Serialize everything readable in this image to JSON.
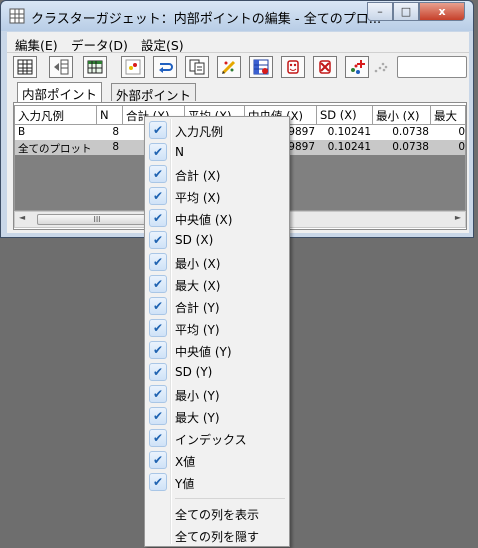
{
  "window": {
    "title": "クラスターガジェット：内部ポイントの編集 - 全てのプロ...",
    "buttons": {
      "minimize": "–",
      "maximize": "□",
      "close": "x"
    }
  },
  "menu": [
    "編集(E)",
    "データ(D)",
    "設定(S)"
  ],
  "toolbar_icons": [
    "worksheet-icon",
    "move-column-icon",
    "table-icon",
    "scatter-icon",
    "undo-loop-icon",
    "copy-icon",
    "edit-pen-icon",
    "grid-select-icon",
    "mask-face-icon",
    "mask-remove-icon",
    "add-points-icon",
    "scatter-gray-icon"
  ],
  "tabs": [
    "内部ポイント",
    "外部ポイント"
  ],
  "table": {
    "columns": [
      "入力凡例",
      "N",
      "合計 (X)",
      "平均 (X)",
      "中央値 (X)",
      "SD (X)",
      "最小 (X)",
      "最大"
    ],
    "rows": [
      [
        "B",
        "8",
        "",
        "",
        "19897",
        "0.10241",
        "0.0738",
        "0"
      ],
      [
        "全てのプロット",
        "8",
        "",
        "",
        "19897",
        "0.10241",
        "0.0738",
        "0"
      ]
    ]
  },
  "scrollbar": {
    "left_arrow": "◄",
    "right_arrow": "►",
    "grip": "III"
  },
  "context_menu": {
    "check_glyph": "✔",
    "items": [
      "入力凡例",
      "N",
      "合計 (X)",
      "平均 (X)",
      "中央値 (X)",
      "SD (X)",
      "最小 (X)",
      "最大 (X)",
      "合計 (Y)",
      "平均 (Y)",
      "中央値 (Y)",
      "SD (Y)",
      "最小 (Y)",
      "最大 (Y)",
      "インデックス",
      "X値",
      "Y値"
    ],
    "show_all": "全ての列を表示",
    "hide_all": "全ての列を隠す"
  }
}
